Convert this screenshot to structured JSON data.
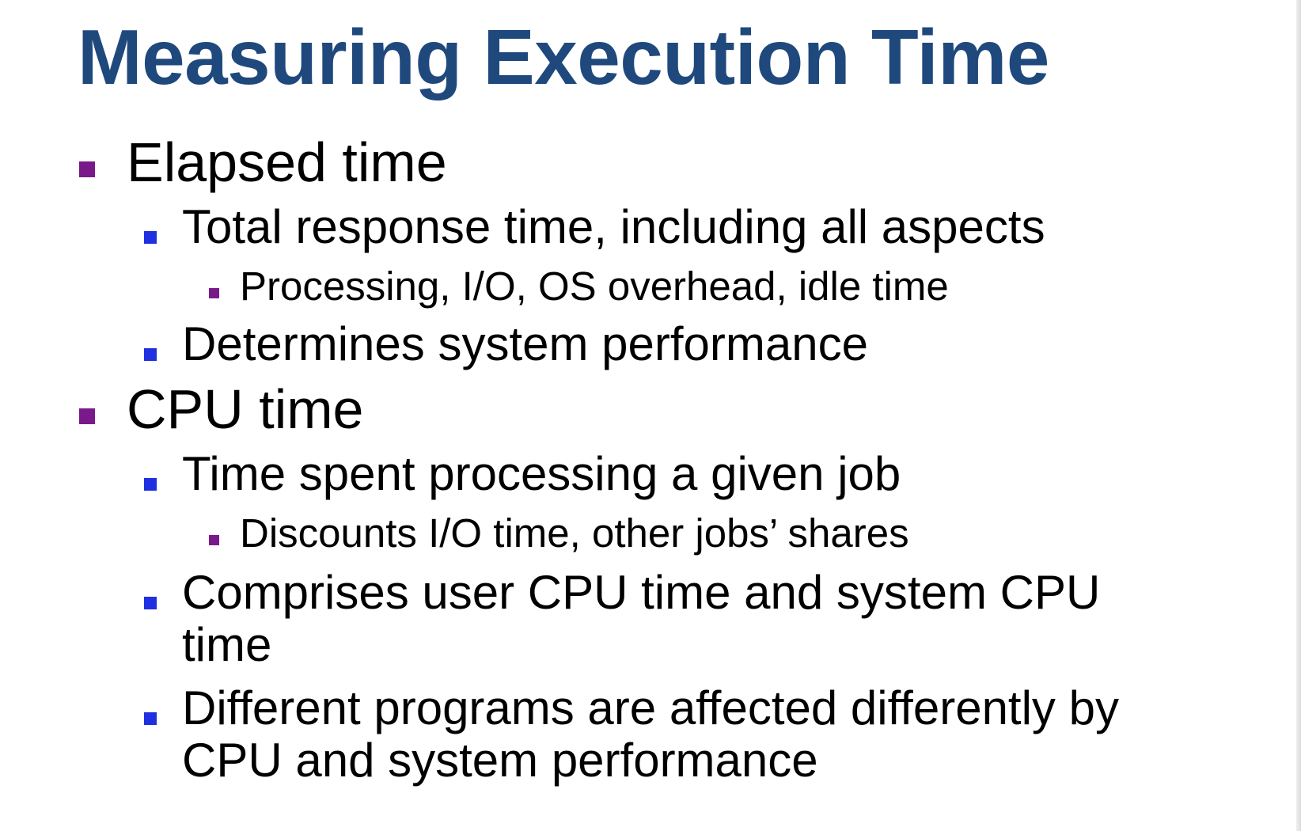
{
  "slide": {
    "title": "Measuring Execution Time",
    "colors": {
      "title": "#1f497d",
      "bullet_level1": "#7a1a8a",
      "bullet_level2": "#1f30e0",
      "bullet_level3": "#7a1a8a",
      "text": "#000000",
      "background": "#ffffff"
    },
    "bullets": [
      {
        "level": 1,
        "text": "Elapsed time"
      },
      {
        "level": 2,
        "text": "Total response time, including all aspects"
      },
      {
        "level": 3,
        "text": "Processing, I/O, OS overhead, idle time"
      },
      {
        "level": 2,
        "text": "Determines system performance"
      },
      {
        "level": 1,
        "text": "CPU time"
      },
      {
        "level": 2,
        "text": "Time spent processing a given job"
      },
      {
        "level": 3,
        "text": "Discounts I/O time, other jobs’ shares"
      },
      {
        "level": 2,
        "text": "Comprises user CPU time and system CPU",
        "continuation": "time"
      },
      {
        "level": 2,
        "text": "Different programs are affected differently by",
        "continuation": "CPU and system performance"
      }
    ]
  }
}
